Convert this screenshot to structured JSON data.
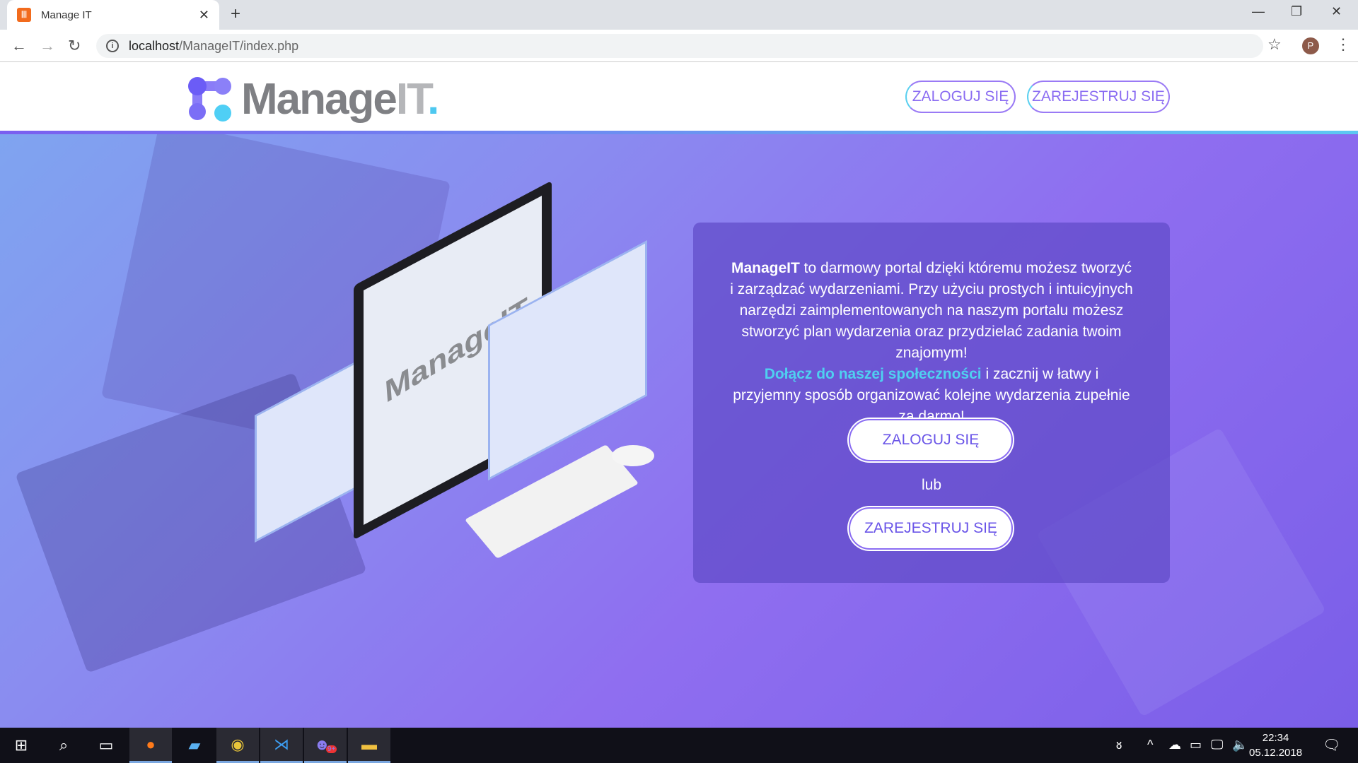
{
  "browser": {
    "tab_title": "Manage IT",
    "url_host": "localhost",
    "url_path": "/ManageIT/index.php",
    "profile_initial": "P"
  },
  "header": {
    "logo_text": "Manage",
    "logo_text_it": "IT",
    "logo_dot": ".",
    "login_label": "ZALOGUJ SIĘ",
    "register_label": "ZAREJESTRUJ SIĘ"
  },
  "hero": {
    "monitor_brand": "ManageIT.",
    "brand": "ManageIT",
    "desc_part1": " to darmowy portal dzięki któremu możesz tworzyć i zarządzać wydarzeniami. Przy użyciu prostych i intuicyjnych narzędzi zaimplementowanych na naszym portalu możesz stworzyć plan wydarzenia oraz przydzielać zadania twoim znajomym!",
    "join_link": "Dołącz do naszej społeczności",
    "desc_part2": " i zacznij w łatwy i przyjemny sposób organizować kolejne wydarzenia zupełnie za darmo!",
    "login_label": "ZALOGUJ SIĘ",
    "or_label": "lub",
    "register_label": "ZAREJESTRUJ SIĘ"
  },
  "taskbar": {
    "time": "22:34",
    "date": "05.12.2018",
    "mail_badge": "9+"
  },
  "colors": {
    "accent_purple": "#8a6cf2",
    "accent_cyan": "#4fd0f0"
  }
}
